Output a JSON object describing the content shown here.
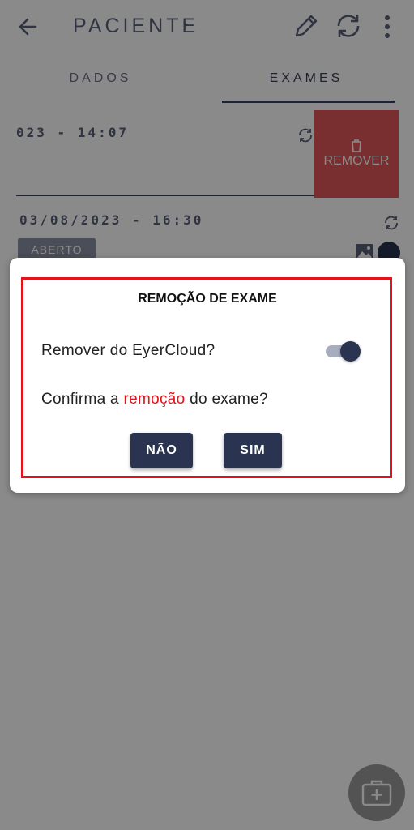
{
  "header": {
    "title": "PACIENTE"
  },
  "tabs": [
    {
      "label": "DADOS"
    },
    {
      "label": "EXAMES"
    }
  ],
  "exams": [
    {
      "datetime": "023 - 14:07",
      "swipe_action_label": "REMOVER"
    },
    {
      "datetime": "03/08/2023 - 16:30",
      "status": "ABERTO"
    }
  ],
  "dialog": {
    "title": "REMOÇÃO DE EXAME",
    "toggle_label": "Remover do EyerCloud?",
    "toggle_on": true,
    "confirm_prefix": "Confirma a ",
    "confirm_highlight": "remoção",
    "confirm_suffix": " do exame?",
    "no_label": "NÃO",
    "yes_label": "SIM"
  },
  "colors": {
    "primary": "#2a3350",
    "danger": "#e05757",
    "highlight_red": "#e3121b",
    "scrim": "rgba(0,0,0,0.46)"
  }
}
